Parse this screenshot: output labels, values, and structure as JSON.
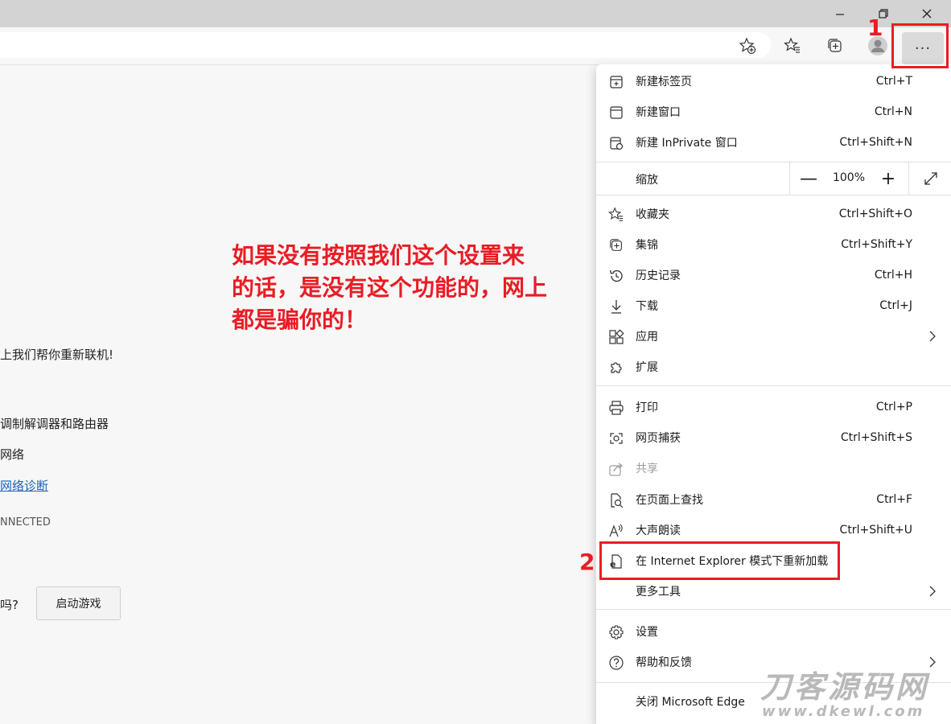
{
  "page": {
    "lines": [
      "上我们帮你重新联机!",
      "调制解调器和路由器",
      "网络",
      "网络诊断",
      "NNECTED",
      "吗?"
    ],
    "game_button": "启动游戏"
  },
  "annotation": {
    "lines": [
      "如果没有按照我们这个设置来",
      "的话，是没有这个功能的，网上",
      "都是骗你的！"
    ],
    "marker1": "1",
    "marker2": "2",
    "color": "#ea1c24"
  },
  "toolbar": {
    "more_label": "···"
  },
  "menu": {
    "new_tab": {
      "label": "新建标签页",
      "shortcut": "Ctrl+T"
    },
    "new_window": {
      "label": "新建窗口",
      "shortcut": "Ctrl+N"
    },
    "new_inprivate": {
      "label": "新建 InPrivate 窗口",
      "shortcut": "Ctrl+Shift+N"
    },
    "zoom": {
      "label": "缩放",
      "value": "100%",
      "minus": "—",
      "plus": "+"
    },
    "favorites": {
      "label": "收藏夹",
      "shortcut": "Ctrl+Shift+O"
    },
    "collections": {
      "label": "集锦",
      "shortcut": "Ctrl+Shift+Y"
    },
    "history": {
      "label": "历史记录",
      "shortcut": "Ctrl+H"
    },
    "downloads": {
      "label": "下载",
      "shortcut": "Ctrl+J"
    },
    "apps": {
      "label": "应用"
    },
    "extensions": {
      "label": "扩展"
    },
    "print": {
      "label": "打印",
      "shortcut": "Ctrl+P"
    },
    "web_capture": {
      "label": "网页捕获",
      "shortcut": "Ctrl+Shift+S"
    },
    "share": {
      "label": "共享"
    },
    "find": {
      "label": "在页面上查找",
      "shortcut": "Ctrl+F"
    },
    "read_aloud": {
      "label": "大声朗读",
      "shortcut": "Ctrl+Shift+U"
    },
    "ie_mode": {
      "label": "在 Internet Explorer 模式下重新加载"
    },
    "more_tools": {
      "label": "更多工具"
    },
    "settings": {
      "label": "设置"
    },
    "help": {
      "label": "帮助和反馈"
    },
    "close": {
      "label": "关闭 Microsoft Edge"
    }
  },
  "watermark": {
    "title": "刀客源码网",
    "subtitle": "www.dkewl.com"
  }
}
